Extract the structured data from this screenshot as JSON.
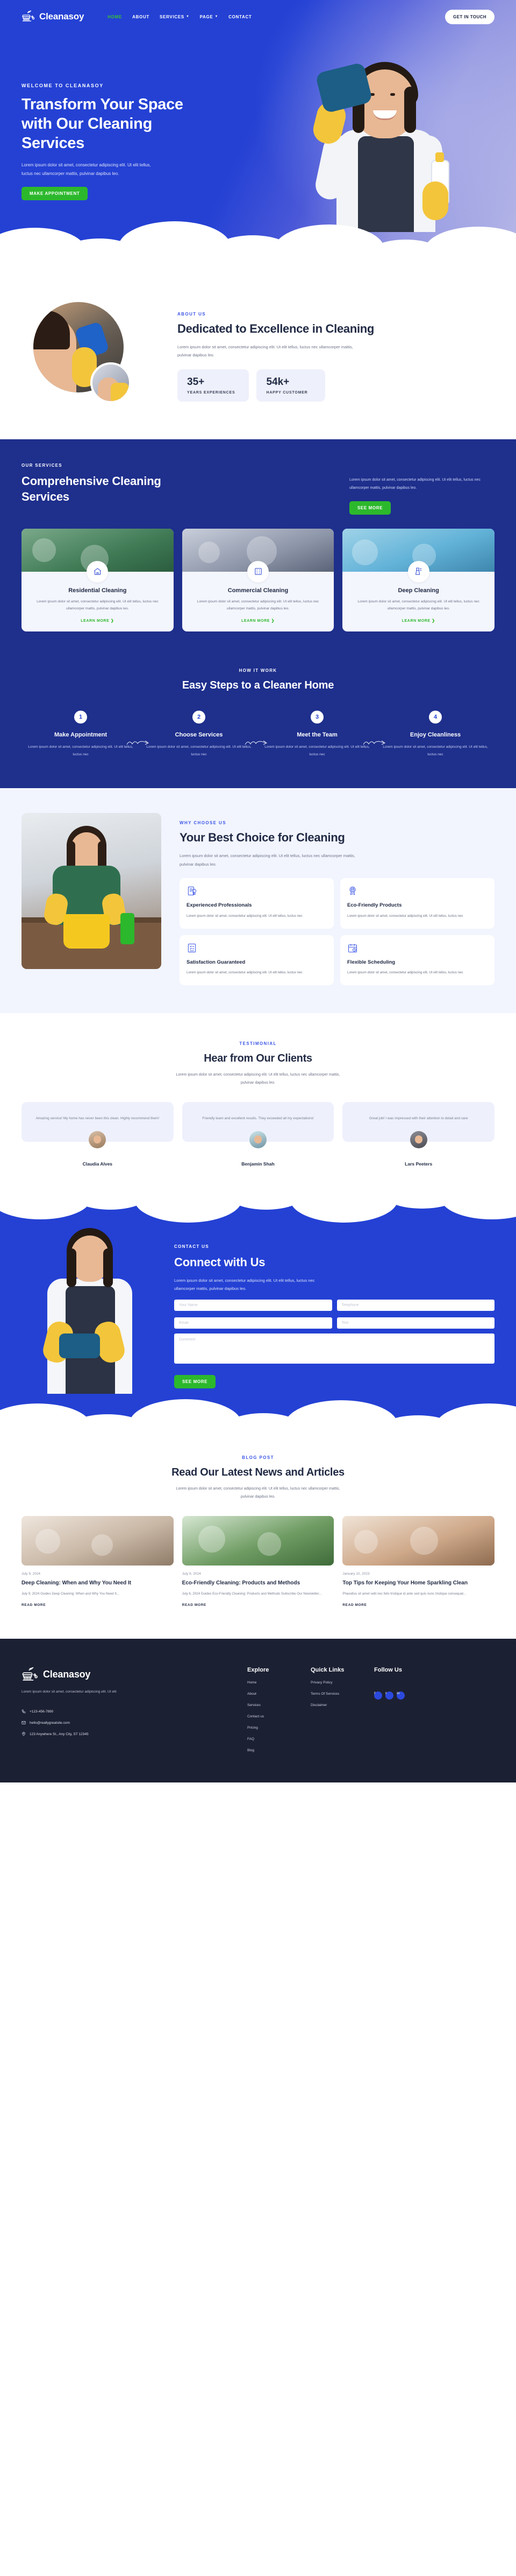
{
  "brand": {
    "name": "Cleanasoy",
    "logo_icon": "cleaning-brush-icon"
  },
  "nav": {
    "links": [
      {
        "label": "HOME",
        "active": true
      },
      {
        "label": "ABOUT",
        "active": false
      },
      {
        "label": "SERVICES",
        "active": false,
        "caret": true
      },
      {
        "label": "PAGE",
        "active": false,
        "caret": true
      },
      {
        "label": "CONTACT",
        "active": false
      }
    ],
    "cta": "GET IN TOUCH"
  },
  "hero": {
    "eyebrow": "WELCOME TO CLEANASOY",
    "title": "Transform Your Space with Our Cleaning Services",
    "paragraph": "Lorem ipsum dolor sit amet, consectetur adipiscing elit. Ut elit tellus, luctus nec ullamcorper mattis, pulvinar dapibus leo.",
    "cta": "MAKE APPOINTMENT"
  },
  "about": {
    "eyebrow": "ABOUT US",
    "title": "Dedicated to Excellence in Cleaning",
    "paragraph": "Lorem ipsum dolor sit amet, consectetur adipiscing elit. Ut elit tellus, luctus nec ullamcorper mattis, pulvinar dapibus leo.",
    "stats": [
      {
        "value": "35+",
        "label": "YEARS EXPERIENCES"
      },
      {
        "value": "54k+",
        "label": "HAPPY CUSTOMER"
      }
    ]
  },
  "services": {
    "eyebrow": "OUR SERVICES",
    "title": "Comprehensive Cleaning Services",
    "paragraph": "Lorem ipsum dolor sit amet, consectetur adipiscing elit. Ut elit tellus, luctus nec ullamcorper mattis, pulvinar dapibus leo.",
    "cta": "SEE MORE",
    "cards": [
      {
        "title": "Residential Cleaning",
        "text": "Lorem ipsum dolor sit amet, consectetur adipiscing elit. Ut elit tellus, luctus nec ullamcorper mattis, pulvinar dapibus leo.",
        "link": "LEARN MORE",
        "icon": "house-cleaning-icon"
      },
      {
        "title": "Commercial Cleaning",
        "text": "Lorem ipsum dolor sit amet, consectetur adipiscing elit. Ut elit tellus, luctus nec ullamcorper mattis, pulvinar dapibus leo.",
        "link": "LEARN MORE",
        "icon": "office-building-icon"
      },
      {
        "title": "Deep Cleaning",
        "text": "Lorem ipsum dolor sit amet, consectetur adipiscing elit. Ut elit tellus, luctus nec ullamcorper mattis, pulvinar dapibus leo.",
        "link": "LEARN MORE",
        "icon": "deep-clean-icon"
      }
    ]
  },
  "steps": {
    "eyebrow": "HOW IT WORK",
    "title": "Easy Steps to a Cleaner Home",
    "items": [
      {
        "num": "1",
        "title": "Make Appointment",
        "text": "Lorem ipsum dolor sit amet, consectetur adipiscing elit. Ut elit tellus, luctus nec"
      },
      {
        "num": "2",
        "title": "Choose Services",
        "text": "Lorem ipsum dolor sit amet, consectetur adipiscing elit. Ut elit tellus, luctus nec"
      },
      {
        "num": "3",
        "title": "Meet the Team",
        "text": "Lorem ipsum dolor sit amet, consectetur adipiscing elit. Ut elit tellus, luctus nec"
      },
      {
        "num": "4",
        "title": "Enjoy Cleanliness",
        "text": "Lorem ipsum dolor sit amet, consectetur adipiscing elit. Ut elit tellus, luctus nec"
      }
    ]
  },
  "why": {
    "eyebrow": "WHY CHOOSE US",
    "title": "Your Best Choice for Cleaning",
    "paragraph": "Lorem ipsum dolor sit amet, consectetur adipiscing elit. Ut elit tellus, luctus nec ullamcorper mattis, pulvinar dapibus leo.",
    "features": [
      {
        "title": "Experienced Professionals",
        "text": "Lorem ipsum dolor sit amet, consectetur adipiscing elit. Ut elit tellus, luctus nec",
        "icon": "certificate-document-icon"
      },
      {
        "title": "Eco-Friendly Products",
        "text": "Lorem ipsum dolor sit amet, consectetur adipiscing elit. Ut elit tellus, luctus nec",
        "icon": "award-badge-icon"
      },
      {
        "title": "Satisfaction Guaranteed",
        "text": "Lorem ipsum dolor sit amet, consectetur adipiscing elit. Ut elit tellus, luctus nec",
        "icon": "checklist-icon"
      },
      {
        "title": "Flexible Scheduling",
        "text": "Lorem ipsum dolor sit amet, consectetur adipiscing elit. Ut elit tellus, luctus nec",
        "icon": "calendar-clock-icon"
      }
    ]
  },
  "testimonial": {
    "eyebrow": "TESTIMONIAL",
    "title": "Hear from Our Clients",
    "paragraph": "Lorem ipsum dolor sit amet, consectetur adipiscing elit. Ut elit tellus, luctus nec ullamcorper mattis, pulvinar dapibus leo.",
    "items": [
      {
        "quote": "Amazing service! My home has never been this clean. Highly recommend them!",
        "name": "Claudia Alves"
      },
      {
        "quote": "Friendly team and excellent results. They exceeded all my expectations!",
        "name": "Benjamin Shah"
      },
      {
        "quote": "Great job! I was impressed with their attention to detail and care",
        "name": "Lars Peeters"
      }
    ]
  },
  "contact": {
    "eyebrow": "CONTACT US",
    "title": "Connect with Us",
    "paragraph": "Lorem ipsum dolor sit amet, consectetur adipiscing elit. Ut elit tellus, luctus nec ullamcorper mattis, pulvinar dapibus leo.",
    "fields": {
      "name": "Your Name",
      "telephone": "Telephone",
      "email": "Email",
      "text": "Text",
      "comment": "Comment"
    },
    "cta": "SEE MORE"
  },
  "blog": {
    "eyebrow": "BLOG POST",
    "title": "Read Our Latest News and Articles",
    "paragraph": "Lorem ipsum dolor sit amet, consectetur adipiscing elit. Ut elit tellus, luctus nec ullamcorper mattis, pulvinar dapibus leo.",
    "posts": [
      {
        "date": "July 9, 2024",
        "title": "Deep Cleaning: When and Why You Need It",
        "text": "July 9, 2024 Guides Deep Cleaning: When and Why You Need It...",
        "link": "READ MORE"
      },
      {
        "date": "July 9, 2024",
        "title": "Eco-Friendly Cleaning: Products and Methods",
        "text": "July 6, 2024 Guides Eco-Friendly Cleaning: Products and Methods Subscribe Our Newsletter...",
        "link": "READ MORE"
      },
      {
        "date": "January 10, 2023",
        "title": "Top Tips for Keeping Your Home Sparkling Clean",
        "text": "Phasellus sit amet velit nec felis tristique id ante sed quis nunc tristique consequat...",
        "link": "READ MORE"
      }
    ]
  },
  "footer": {
    "tagline": "Lorem ipsum dolor sit amet, consectetur adipiscing elit. Ut elit",
    "phone": "+123-456-7890",
    "email": "hello@reallygreatsite.com",
    "address": "123 Anywhere St., Any City, ST 12345",
    "columns": [
      {
        "heading": "Explore",
        "links": [
          "Home",
          "About",
          "Services",
          "Contact us",
          "Pricing",
          "FAQ",
          "Blog"
        ]
      },
      {
        "heading": "Quick Links",
        "links": [
          "Privacy Policy",
          "Terms Of Services",
          "Disclaimer"
        ]
      }
    ],
    "follow_heading": "Follow Us",
    "social": [
      {
        "name": "facebook-icon",
        "glyph": "f"
      },
      {
        "name": "twitter-icon",
        "glyph": "t"
      },
      {
        "name": "linkedin-icon",
        "glyph": "in"
      }
    ]
  },
  "colors": {
    "brand_blue": "#2441d4",
    "deep_blue": "#1e2f8c",
    "green": "#2cb82c",
    "dark": "#1c2033"
  }
}
